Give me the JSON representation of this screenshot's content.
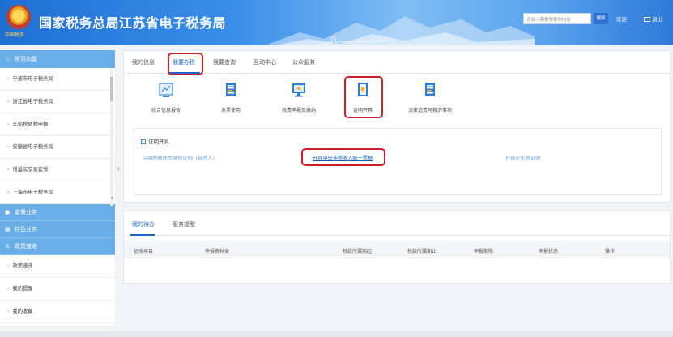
{
  "header": {
    "title": "国家税务总局江苏省电子税务局",
    "emblem_text": "中国税务",
    "search_placeholder": "请输入需要搜索的内容",
    "search_button": "搜索",
    "welcome": "欢迎",
    "logout": "退出"
  },
  "sidebar": {
    "common_title": "常用功能",
    "items": [
      "宁波市电子税务局",
      "浙江省电子税务局",
      "车船税纳税申报",
      "安徽省电子税务局",
      "增量房交易套餐",
      "上海市电子税务局"
    ],
    "groups": [
      "套餐业务",
      "特色业务",
      "政策速递"
    ],
    "bottom_items": [
      "政策速递",
      "我的提醒",
      "我的收藏"
    ],
    "collapse": "«"
  },
  "main": {
    "tabs": [
      "我的信息",
      "我要办税",
      "我要查询",
      "互动中心",
      "公众服务"
    ],
    "active_tab": "我要办税",
    "icons": [
      {
        "label": "综合信息报告",
        "icon": "report-icon"
      },
      {
        "label": "发票使用",
        "icon": "invoice-icon"
      },
      {
        "label": "税费申报及缴纳",
        "icon": "monitor-icon"
      },
      {
        "label": "证明开具",
        "icon": "certificate-icon"
      },
      {
        "label": "法律追责与救济事项",
        "icon": "document-icon"
      }
    ],
    "cert": {
      "title": "证明开具",
      "links": [
        "中国税收居民身份证明（自然人）",
        "开具中央非税收入统一票据",
        "开具无欠税证明"
      ]
    }
  },
  "todo": {
    "tabs": [
      "我的待办",
      "服务提醒"
    ],
    "columns": [
      "征收项目",
      "申报表种类",
      "税款所属期起",
      "税款所属期止",
      "申报期限",
      "申报状态",
      "操作"
    ]
  },
  "colors": {
    "accent": "#1e67c9",
    "highlight": "#cc1f2c",
    "sidebar_head": "#6aaee8"
  }
}
